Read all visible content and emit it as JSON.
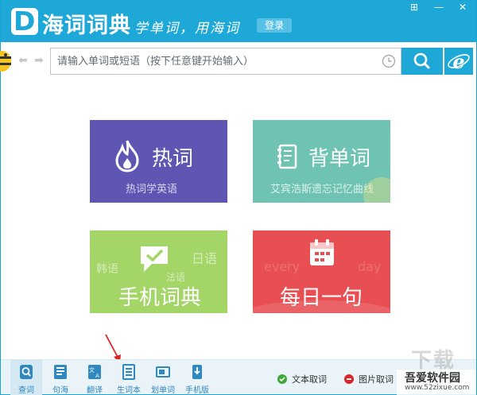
{
  "app": {
    "logo_letter": "D",
    "title": "海词词典",
    "slogan": "学单词，用海词",
    "login_label": "登录"
  },
  "window_controls": [
    "⊞",
    "—",
    "✕"
  ],
  "search": {
    "placeholder": "请输入单词或短语（按下任意键开始输入）",
    "value": ""
  },
  "tiles": {
    "hot": {
      "title": "热词",
      "subtitle": "热词学英语",
      "icon": "flame-icon",
      "color": "#5f56b3"
    },
    "words": {
      "title": "背单词",
      "subtitle": "艾宾浩斯遗忘记忆曲线",
      "icon": "notebook-icon",
      "color": "#6ec3b3"
    },
    "mobile": {
      "title": "手机词典",
      "deco": [
        "韩语",
        "日语",
        "法语"
      ],
      "icon": "chat-check-icon",
      "color": "#a4d567"
    },
    "daily": {
      "title": "每日一句",
      "deco_left": "every",
      "deco_right": "day",
      "icon": "calendar-icon",
      "color": "#e84f52"
    }
  },
  "bottom_nav": [
    {
      "label": "查词",
      "icon": "search-dict-icon",
      "active": true
    },
    {
      "label": "句海",
      "icon": "sentence-icon",
      "active": false
    },
    {
      "label": "翻译",
      "icon": "translate-icon",
      "active": false
    },
    {
      "label": "生词本",
      "icon": "wordbook-icon",
      "active": false
    },
    {
      "label": "划单词",
      "icon": "highlight-word-icon",
      "active": false
    },
    {
      "label": "手机版",
      "icon": "mobile-icon",
      "active": false
    }
  ],
  "options": {
    "text_capture": {
      "label": "文本取词",
      "enabled": true
    },
    "image_capture": {
      "label": "图片取词",
      "enabled": false
    }
  },
  "watermark": {
    "title": "吾爱软件园",
    "url": "www.52zixue.com",
    "overlay": "下载"
  }
}
